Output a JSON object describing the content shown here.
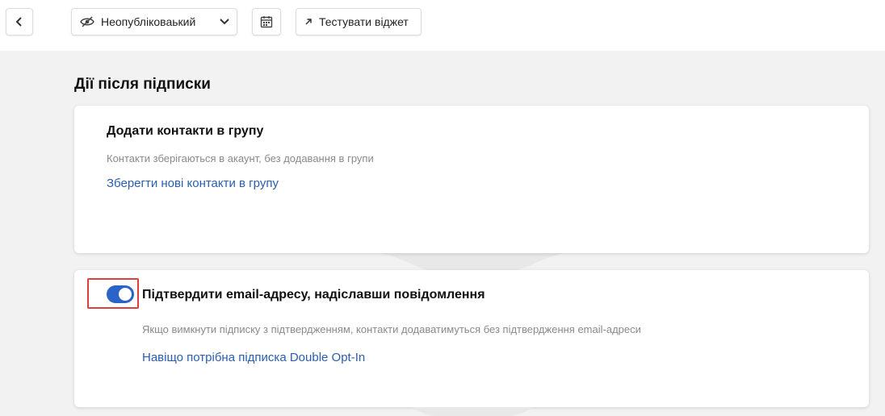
{
  "toolbar": {
    "status_label": "Неопубліковаький",
    "test_label": "Тестувати віджет"
  },
  "section": {
    "title": "Дії після підписки"
  },
  "card_group": {
    "title": "Додати контакти в групу",
    "description": "Контакти зберігаються в акаунт, без додавання в групи",
    "link": "Зберегти нові контакти в групу"
  },
  "card_doi": {
    "title": "Підтвердити email-адресу, надіславши повідомлення",
    "description": "Якщо вимкнути підписку з підтвердженням, контакти додаватимуться без підтвердження email-адреси",
    "link": "Навіщо потрібна підписка Double Opt-In",
    "toggle_on": true
  },
  "icons": {
    "back": "chevron-left-icon",
    "status": "eye-off-icon",
    "dropdown": "chevron-down-icon",
    "calendar": "calendar-icon",
    "test": "arrow-up-right-icon"
  },
  "colors": {
    "accent": "#2b63c9",
    "link": "#2a5db0",
    "highlight": "#e03d3d"
  }
}
